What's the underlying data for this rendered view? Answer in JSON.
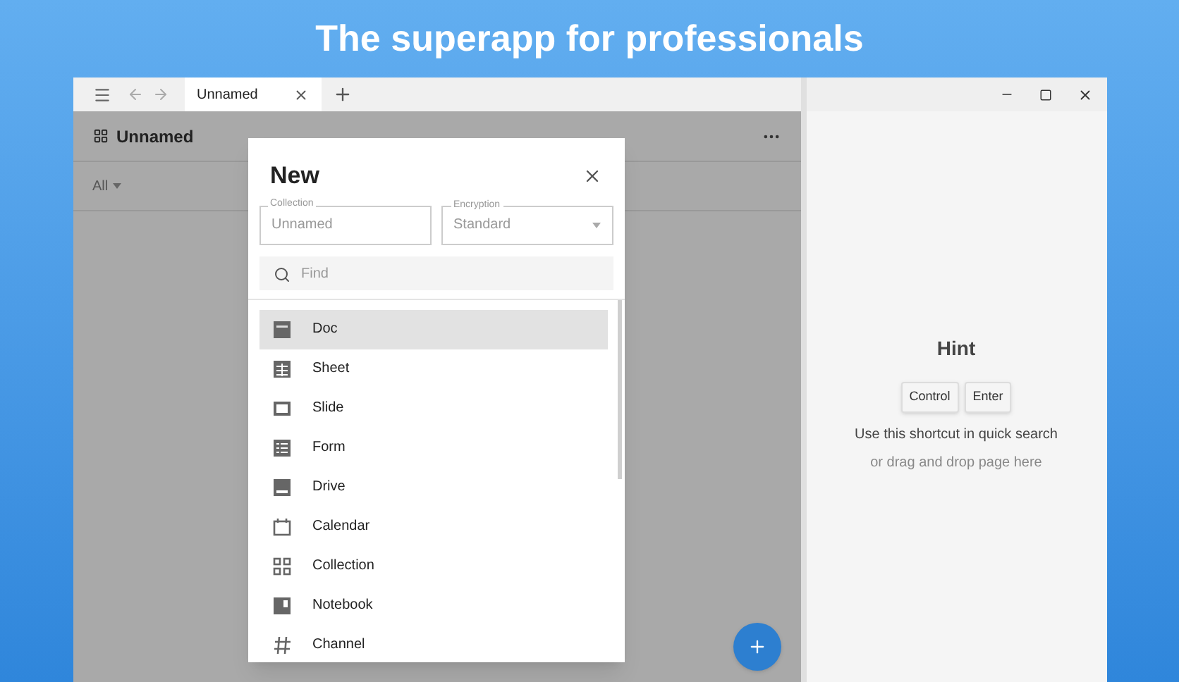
{
  "headline": "The superapp for professionals",
  "tabs": [
    {
      "label": "Unnamed",
      "selected": true
    }
  ],
  "page": {
    "title": "Unnamed",
    "filter": "All"
  },
  "dialog": {
    "title": "New",
    "fields": [
      {
        "kind": "text",
        "label": "Collection",
        "placeholder": "Unnamed"
      },
      {
        "kind": "select",
        "label": "Encryption",
        "value": "Standard"
      }
    ],
    "search": {
      "placeholder": "Find"
    },
    "items": [
      {
        "kind": "doc",
        "label": "Doc",
        "selected": true
      },
      {
        "kind": "sheet",
        "label": "Sheet",
        "selected": false
      },
      {
        "kind": "slide",
        "label": "Slide",
        "selected": false
      },
      {
        "kind": "form",
        "label": "Form",
        "selected": false
      },
      {
        "kind": "drive",
        "label": "Drive",
        "selected": false
      },
      {
        "kind": "calendar",
        "label": "Calendar",
        "selected": false
      },
      {
        "kind": "collection",
        "label": "Collection",
        "selected": false
      },
      {
        "kind": "notebook",
        "label": "Notebook",
        "selected": false
      },
      {
        "kind": "channel",
        "label": "Channel",
        "selected": false
      }
    ]
  },
  "hint": {
    "title": "Hint",
    "keys": [
      "Control",
      "Enter"
    ],
    "lines": [
      "Use this shortcut in quick search",
      "or drag and drop page here"
    ]
  }
}
